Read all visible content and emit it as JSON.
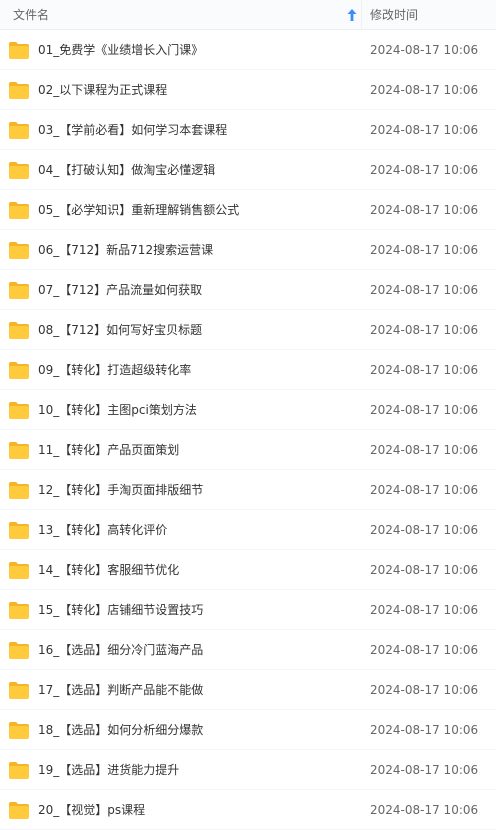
{
  "header": {
    "name_label": "文件名",
    "time_label": "修改时间",
    "sort_icon": "arrow-up-icon"
  },
  "colors": {
    "folder": "#ffcb3d",
    "folder_tab": "#f5b52a",
    "sort_arrow": "#3b8cff"
  },
  "files": [
    {
      "name": "01_免费学《业绩增长入门课》",
      "time": "2024-08-17 10:06",
      "icon": "folder-icon"
    },
    {
      "name": "02_以下课程为正式课程",
      "time": "2024-08-17 10:06",
      "icon": "folder-icon"
    },
    {
      "name": "03_【学前必看】如何学习本套课程",
      "time": "2024-08-17 10:06",
      "icon": "folder-icon"
    },
    {
      "name": "04_【打破认知】做淘宝必懂逻辑",
      "time": "2024-08-17 10:06",
      "icon": "folder-icon"
    },
    {
      "name": "05_【必学知识】重新理解销售额公式",
      "time": "2024-08-17 10:06",
      "icon": "folder-icon"
    },
    {
      "name": "06_【712】新品712搜索运营课",
      "time": "2024-08-17 10:06",
      "icon": "folder-icon"
    },
    {
      "name": "07_【712】产品流量如何获取",
      "time": "2024-08-17 10:06",
      "icon": "folder-icon"
    },
    {
      "name": "08_【712】如何写好宝贝标题",
      "time": "2024-08-17 10:06",
      "icon": "folder-icon"
    },
    {
      "name": "09_【转化】打造超级转化率",
      "time": "2024-08-17 10:06",
      "icon": "folder-icon"
    },
    {
      "name": "10_【转化】主图pci策划方法",
      "time": "2024-08-17 10:06",
      "icon": "folder-icon"
    },
    {
      "name": "11_【转化】产品页面策划",
      "time": "2024-08-17 10:06",
      "icon": "folder-icon"
    },
    {
      "name": "12_【转化】手淘页面排版细节",
      "time": "2024-08-17 10:06",
      "icon": "folder-icon"
    },
    {
      "name": "13_【转化】高转化评价",
      "time": "2024-08-17 10:06",
      "icon": "folder-icon"
    },
    {
      "name": "14_【转化】客服细节优化",
      "time": "2024-08-17 10:06",
      "icon": "folder-icon"
    },
    {
      "name": "15_【转化】店铺细节设置技巧",
      "time": "2024-08-17 10:06",
      "icon": "folder-icon"
    },
    {
      "name": "16_【选品】细分冷门蓝海产品",
      "time": "2024-08-17 10:06",
      "icon": "folder-icon"
    },
    {
      "name": "17_【选品】判断产品能不能做",
      "time": "2024-08-17 10:06",
      "icon": "folder-icon"
    },
    {
      "name": "18_【选品】如何分析细分爆款",
      "time": "2024-08-17 10:06",
      "icon": "folder-icon"
    },
    {
      "name": "19_【选品】进货能力提升",
      "time": "2024-08-17 10:06",
      "icon": "folder-icon"
    },
    {
      "name": "20_【视觉】ps课程",
      "time": "2024-08-17 10:06",
      "icon": "folder-icon"
    }
  ]
}
